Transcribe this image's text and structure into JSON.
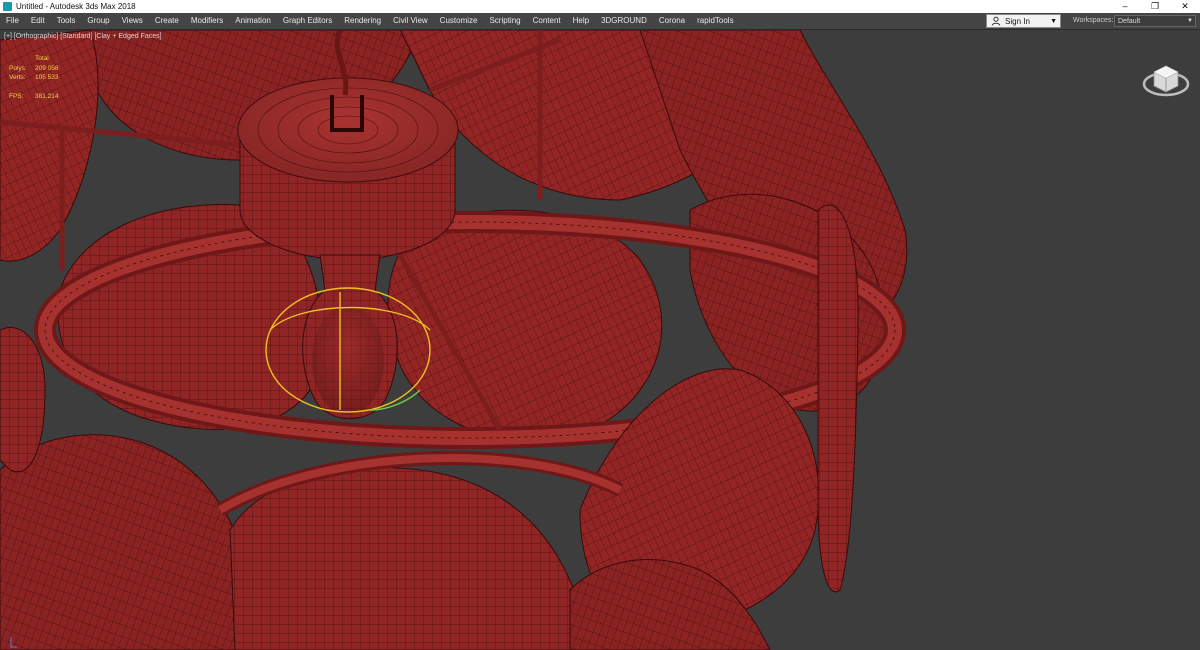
{
  "window": {
    "title": "Untitled - Autodesk 3ds Max 2018",
    "controls": {
      "minimize": "–",
      "restore": "❐",
      "close": "✕"
    }
  },
  "menu": {
    "items": [
      "File",
      "Edit",
      "Tools",
      "Group",
      "Views",
      "Create",
      "Modifiers",
      "Animation",
      "Graph Editors",
      "Rendering",
      "Civil View",
      "Customize",
      "Scripting",
      "Content",
      "Help",
      "3DGROUND",
      "Corona",
      "rapidTools"
    ]
  },
  "account": {
    "sign_in_label": "Sign In"
  },
  "workspace": {
    "label": "Workspaces:",
    "value": "Default"
  },
  "viewport": {
    "label": "[+] [Orthographic] [Standard] [Clay + Edged Faces]",
    "stats": {
      "header": "Total",
      "polys_label": "Polys:",
      "polys_value": "209 058",
      "verts_label": "Verts:",
      "verts_value": "105 533",
      "fps_label": "FPS:",
      "fps_value": "381,214"
    },
    "background_color": "#3d3d3d",
    "model_color": "#8f2524",
    "selection_color": "#f0c020"
  },
  "icons": {
    "app": "3ds-max-app-icon",
    "user": "user-icon",
    "viewcube": "viewcube-icon",
    "axis": "axis-tripod-icon"
  }
}
